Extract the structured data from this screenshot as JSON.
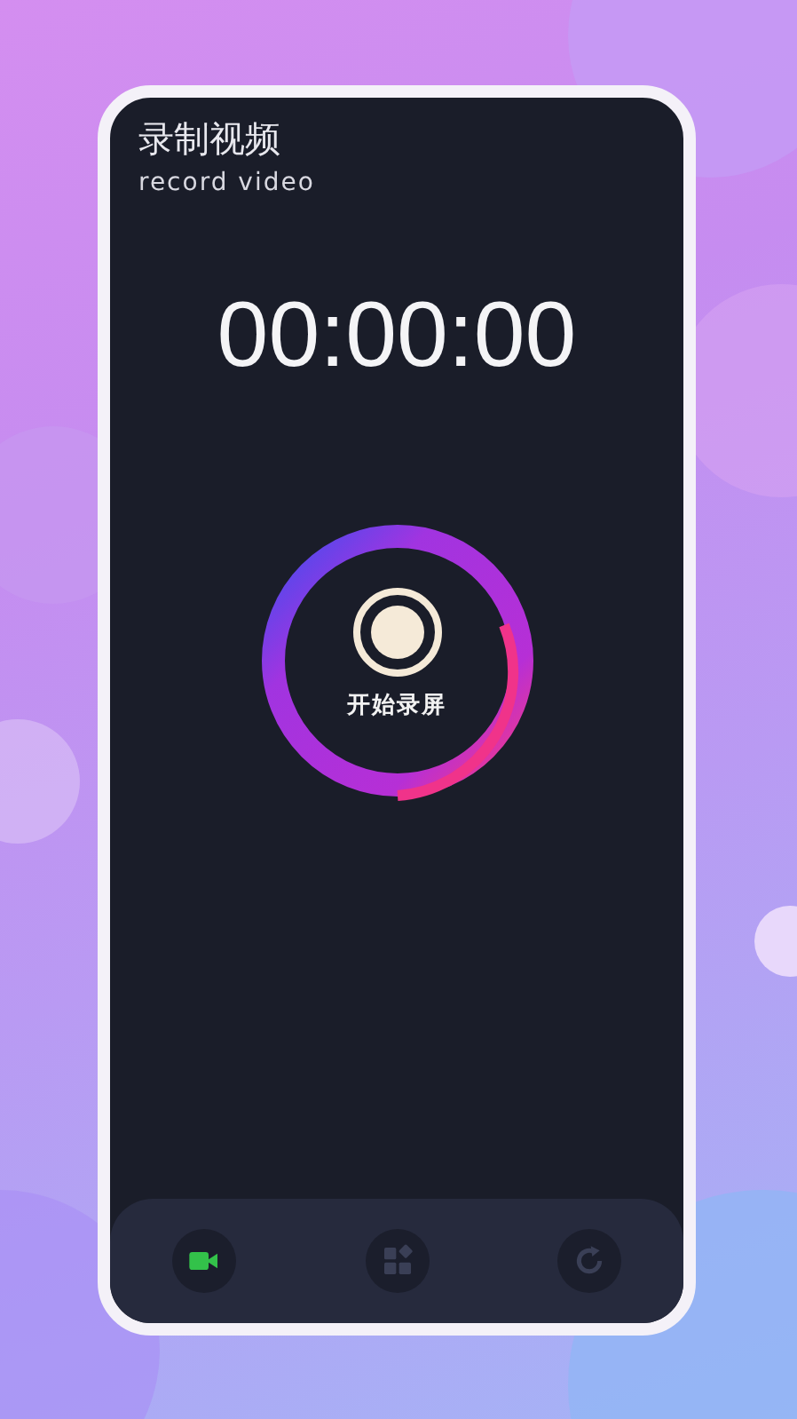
{
  "header": {
    "title": "录制视频",
    "subtitle": "record video"
  },
  "timer": "00:00:00",
  "record_button": {
    "label": "开始录屏"
  },
  "tab_bar": [
    {
      "kind": "video",
      "selected": true
    },
    {
      "kind": "apps",
      "selected": false
    },
    {
      "kind": "refresh",
      "selected": false
    }
  ]
}
